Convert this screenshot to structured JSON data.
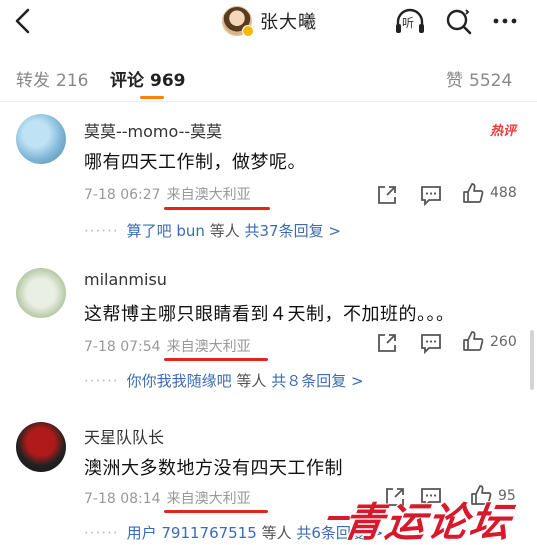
{
  "header": {
    "title": "张大曦",
    "listen_label": "听",
    "icons": [
      "back-arrow-icon",
      "verified-badge-icon",
      "headphones-icon",
      "search-icon",
      "more-icon"
    ]
  },
  "tabs": {
    "repost": {
      "label": "转发",
      "count": "216"
    },
    "comment": {
      "label": "评论",
      "count": "969"
    },
    "like": {
      "label": "赞",
      "count": "5524"
    }
  },
  "comments": [
    {
      "name": "莫莫--momo--莫莫",
      "hot_tag": "热评",
      "text": "哪有四天工作制，做梦呢。",
      "time": "7-18 06:27",
      "location": "来自澳大利亚",
      "likes": "488",
      "replies": {
        "prefix": "算了吧 bun",
        "mid": "等人",
        "suffix": "共37条回复 >"
      }
    },
    {
      "name": "milanmisu",
      "text": "这帮博主哪只眼睛看到４天制，不加班的。。。",
      "time": "7-18 07:54",
      "location": "来自澳大利亚",
      "likes": "260",
      "replies": {
        "prefix": "你你我我随缘吧",
        "mid": "等人",
        "suffix": "共８条回复 >"
      }
    },
    {
      "name": "天星队队长",
      "text": "澳洲大多数地方没有四天工作制",
      "time": "7-18 08:14",
      "location": "来自澳大利亚",
      "likes": "95",
      "replies": {
        "prefix": "用户 7911767515",
        "mid": "等人",
        "suffix": "共6条回复 >"
      }
    }
  ],
  "watermark": {
    "text": "青运论坛"
  },
  "colors": {
    "accent": "#ff8200",
    "link": "#3b6bb4",
    "annotation_red": "#e0261b"
  }
}
